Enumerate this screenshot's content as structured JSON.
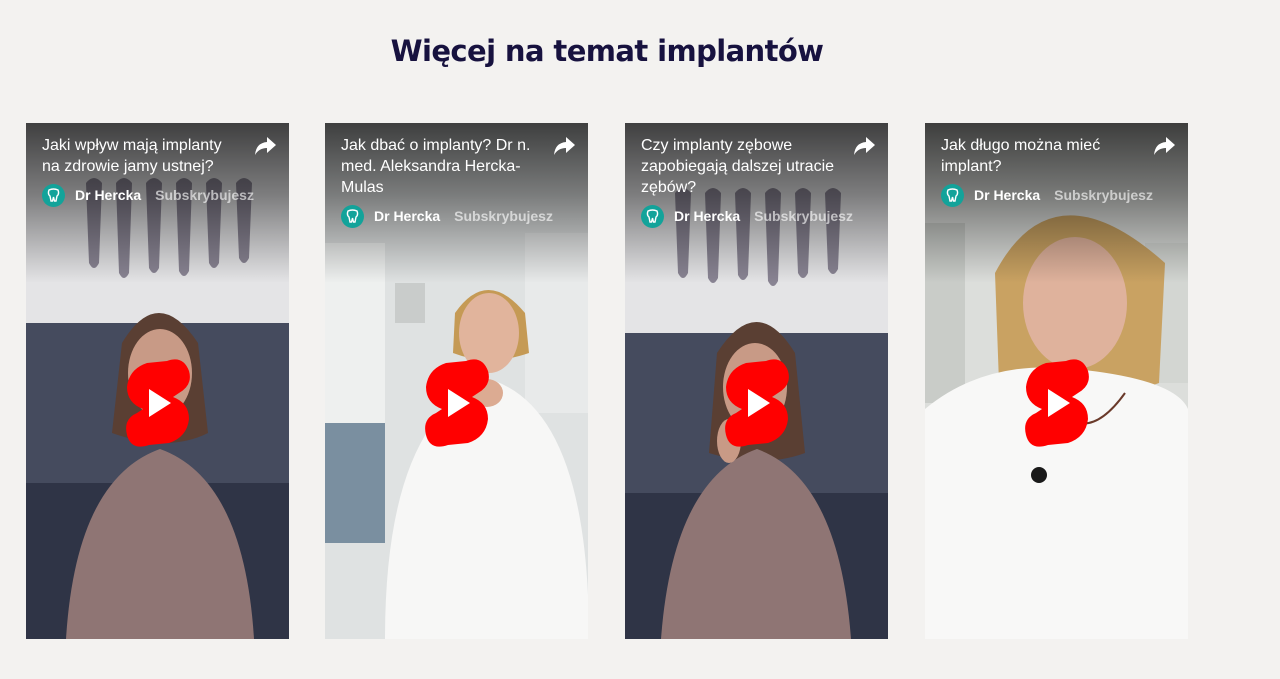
{
  "section": {
    "title": "Więcej na temat implantów"
  },
  "videos": [
    {
      "title": "Jaki wpływ mają implanty na zdrowie jamy ustnej?",
      "channel": "Dr Hercka",
      "subscribe_label": "Subskrybujesz"
    },
    {
      "title": "Jak dbać o implanty? Dr n. med. Aleksandra Hercka-Mulas",
      "channel": "Dr Hercka",
      "subscribe_label": "Subskrybujesz"
    },
    {
      "title": "Czy implanty zębowe zapobiegają dalszej utracie zębów?",
      "channel": "Dr Hercka",
      "subscribe_label": "Subskrybujesz"
    },
    {
      "title": "Jak długo można mieć implant?",
      "channel": "Dr Hercka",
      "subscribe_label": "Subskrybujesz"
    }
  ],
  "icons": {
    "share": "share-arrow-icon",
    "play": "youtube-shorts-play-icon",
    "avatar": "tooth-logo-icon"
  },
  "colors": {
    "title": "#17123f",
    "play_red": "#ff0000",
    "avatar_teal": "#13a39a"
  }
}
